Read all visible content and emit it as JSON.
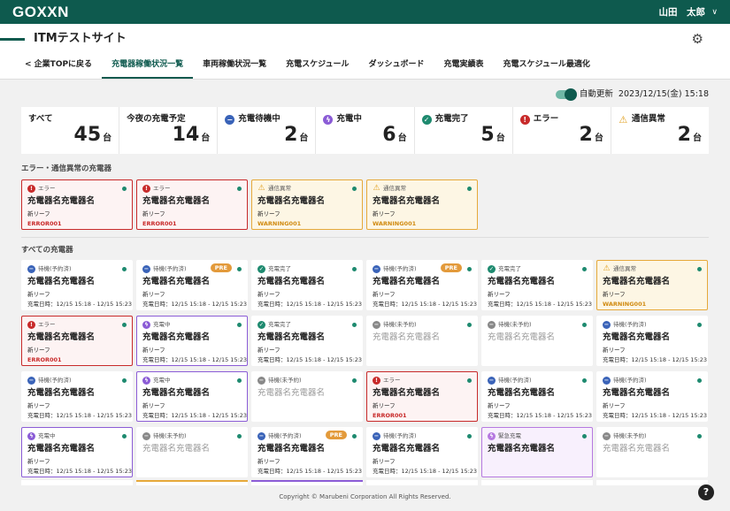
{
  "topbar": {
    "logo": "GOXXN",
    "user_name": "山田　太郎",
    "user_chevron": "∨"
  },
  "header": {
    "site_title": "ITMテストサイト",
    "gear_icon": "⚙"
  },
  "nav": {
    "back_label": "< 企業TOPに戻る",
    "tabs": [
      "充電器稼働状況一覧",
      "車両稼働状況一覧",
      "充電スケジュール",
      "ダッシュボード",
      "充電実績表",
      "充電スケジュール最適化"
    ],
    "active_tab": 0
  },
  "auto_update": {
    "label": "自動更新",
    "datetime": "2023/12/15(金) 15:18",
    "enabled": true
  },
  "stats": [
    {
      "label": "すべて",
      "value": "45",
      "unit": "台",
      "icon": ""
    },
    {
      "label": "今夜の充電予定",
      "value": "14",
      "unit": "台",
      "icon": ""
    },
    {
      "label": "充電待機中",
      "value": "2",
      "unit": "台",
      "icon": "minus-circle-icon"
    },
    {
      "label": "充電中",
      "value": "6",
      "unit": "台",
      "icon": "bolt-circle-icon"
    },
    {
      "label": "充電完了",
      "value": "5",
      "unit": "台",
      "icon": "check-circle-icon"
    },
    {
      "label": "エラー",
      "value": "2",
      "unit": "台",
      "icon": "exclamation-circle-icon"
    },
    {
      "label": "通信異常",
      "value": "2",
      "unit": "台",
      "icon": "warning-triangle-icon"
    }
  ],
  "sections": {
    "alerts_title": "エラー・通信異常の充電器",
    "all_title": "すべての充電器"
  },
  "alert_cards": [
    {
      "type": "error",
      "status": "エラー",
      "name": "充電器名充電器名",
      "model": "新リーフ",
      "code": "ERROR001"
    },
    {
      "type": "error",
      "status": "エラー",
      "name": "充電器名充電器名",
      "model": "新リーフ",
      "code": "ERROR001"
    },
    {
      "type": "warning",
      "status": "通信異常",
      "name": "充電器名充電器名",
      "model": "新リーフ",
      "code": "WARNING001"
    },
    {
      "type": "warning",
      "status": "通信異常",
      "name": "充電器名充電器名",
      "model": "新リーフ",
      "code": "WARNING001"
    }
  ],
  "all_cards": [
    {
      "type": "waiting",
      "status": "待機(予約済)",
      "name": "充電器名充電器名",
      "model": "新リーフ",
      "time": "充電日時：12/15 15:18 - 12/15 15:23"
    },
    {
      "type": "waiting",
      "status": "待機(予約済)",
      "pre": "PRE",
      "name": "充電器名充電器名",
      "model": "新リーフ",
      "time": "充電日時：12/15 15:18 - 12/15 15:23"
    },
    {
      "type": "done",
      "status": "充電完了",
      "name": "充電器名充電器名",
      "model": "新リーフ",
      "time": "充電日時：12/15 15:18 - 12/15 15:23"
    },
    {
      "type": "waiting",
      "status": "待機(予約済)",
      "pre": "PRE",
      "name": "充電器名充電器名",
      "model": "新リーフ",
      "time": "充電日時：12/15 15:18 - 12/15 15:23"
    },
    {
      "type": "done",
      "status": "充電完了",
      "name": "充電器名充電器名",
      "model": "新リーフ",
      "time": "充電日時：12/15 15:18 - 12/15 15:23"
    },
    {
      "type": "warning",
      "status": "通信異常",
      "name": "充電器名充電器名",
      "model": "新リーフ",
      "code": "WARNING001"
    },
    {
      "type": "error",
      "status": "エラー",
      "name": "充電器名充電器名",
      "model": "新リーフ",
      "code": "ERROR001"
    },
    {
      "type": "charging",
      "status": "充電中",
      "name": "充電器名充電器名",
      "model": "新リーフ",
      "time": "充電日時：12/15 15:18 - 12/15 15:23"
    },
    {
      "type": "done",
      "status": "充電完了",
      "name": "充電器名充電器名",
      "model": "新リーフ",
      "time": "充電日時：12/15 15:18 - 12/15 15:23"
    },
    {
      "type": "idle",
      "status": "待機(未予約)",
      "name": "充電器名充電器名"
    },
    {
      "type": "idle",
      "status": "待機(未予約)",
      "name": "充電器名充電器名"
    },
    {
      "type": "waiting",
      "status": "待機(予約済)",
      "name": "充電器名充電器名",
      "model": "新リーフ",
      "time": "充電日時：12/15 15:18 - 12/15 15:23"
    },
    {
      "type": "waiting",
      "status": "待機(予約済)",
      "name": "充電器名充電器名",
      "model": "新リーフ",
      "time": "充電日時：12/15 15:18 - 12/15 15:23"
    },
    {
      "type": "charging",
      "status": "充電中",
      "name": "充電器名充電器名",
      "model": "新リーフ",
      "time": "充電日時：12/15 15:18 - 12/15 15:23"
    },
    {
      "type": "idle",
      "status": "待機(未予約)",
      "name": "充電器名充電器名"
    },
    {
      "type": "error",
      "status": "エラー",
      "name": "充電器名充電器名",
      "model": "新リーフ",
      "code": "ERROR001"
    },
    {
      "type": "waiting",
      "status": "待機(予約済)",
      "name": "充電器名充電器名",
      "model": "新リーフ",
      "time": "充電日時：12/15 15:18 - 12/15 15:23"
    },
    {
      "type": "waiting",
      "status": "待機(予約済)",
      "name": "充電器名充電器名",
      "model": "新リーフ",
      "time": "充電日時：12/15 15:18 - 12/15 15:23"
    },
    {
      "type": "charging",
      "status": "充電中",
      "name": "充電器名充電器名",
      "model": "新リーフ",
      "time": "充電日時：12/15 15:18 - 12/15 15:23"
    },
    {
      "type": "idle",
      "status": "待機(未予約)",
      "name": "充電器名充電器名"
    },
    {
      "type": "waiting",
      "status": "待機(予約済)",
      "pre": "PRE",
      "name": "充電器名充電器名",
      "model": "新リーフ",
      "time": "充電日時：12/15 15:18 - 12/15 15:23"
    },
    {
      "type": "waiting",
      "status": "待機(予約済)",
      "name": "充電器名充電器名",
      "model": "新リーフ",
      "time": "充電日時：12/15 15:18 - 12/15 15:23"
    },
    {
      "type": "urgent",
      "status": "緊急充電",
      "name": "充電器名充電器名"
    },
    {
      "type": "idle",
      "status": "待機(未予約)",
      "name": "充電器名充電器名"
    }
  ],
  "footer": {
    "copyright": "Copyright © Marubeni Corporation All Rights Reserved.",
    "help": "?"
  },
  "colors": {
    "brand": "#0e5a4e",
    "error": "#c82a2a",
    "warning": "#e6a93a",
    "charging": "#8b5cd6",
    "done": "#1e8a6f",
    "waiting": "#3a63b8",
    "idle": "#888888",
    "pre": "#e39a3b"
  }
}
